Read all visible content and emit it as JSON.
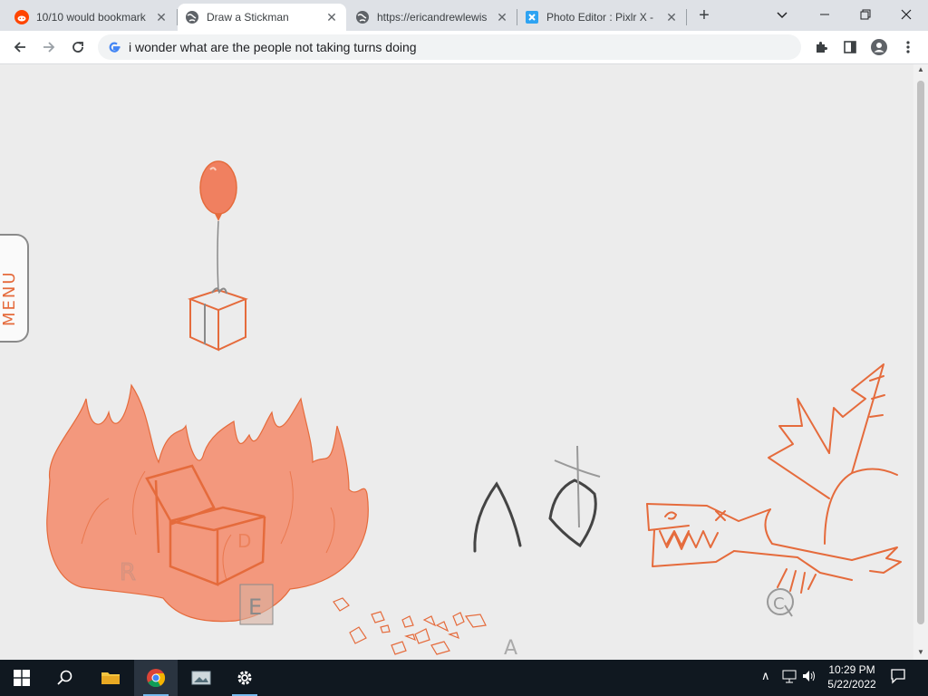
{
  "browser": {
    "tabs": [
      {
        "title": "10/10 would bookmark",
        "favicon": "reddit-icon",
        "active": false
      },
      {
        "title": "Draw a Stickman",
        "favicon": "globe-icon",
        "active": true
      },
      {
        "title": "https://ericandrewlewis",
        "favicon": "globe-icon",
        "active": false
      },
      {
        "title": "Photo Editor : Pixlr X -",
        "favicon": "pixlr-icon",
        "active": false
      }
    ],
    "omnibox_text": "i wonder what are the people not taking turns doing",
    "accent": "#1a73e8"
  },
  "page": {
    "menu_label": "MENU",
    "background": "#ececec",
    "stroke_color": "#e56b3c"
  },
  "taskbar": {
    "time": "10:29 PM",
    "date": "5/22/2022",
    "pinned": [
      "start-icon",
      "search-icon",
      "file-explorer-icon",
      "chrome-icon",
      "photos-icon",
      "settings-icon"
    ]
  }
}
